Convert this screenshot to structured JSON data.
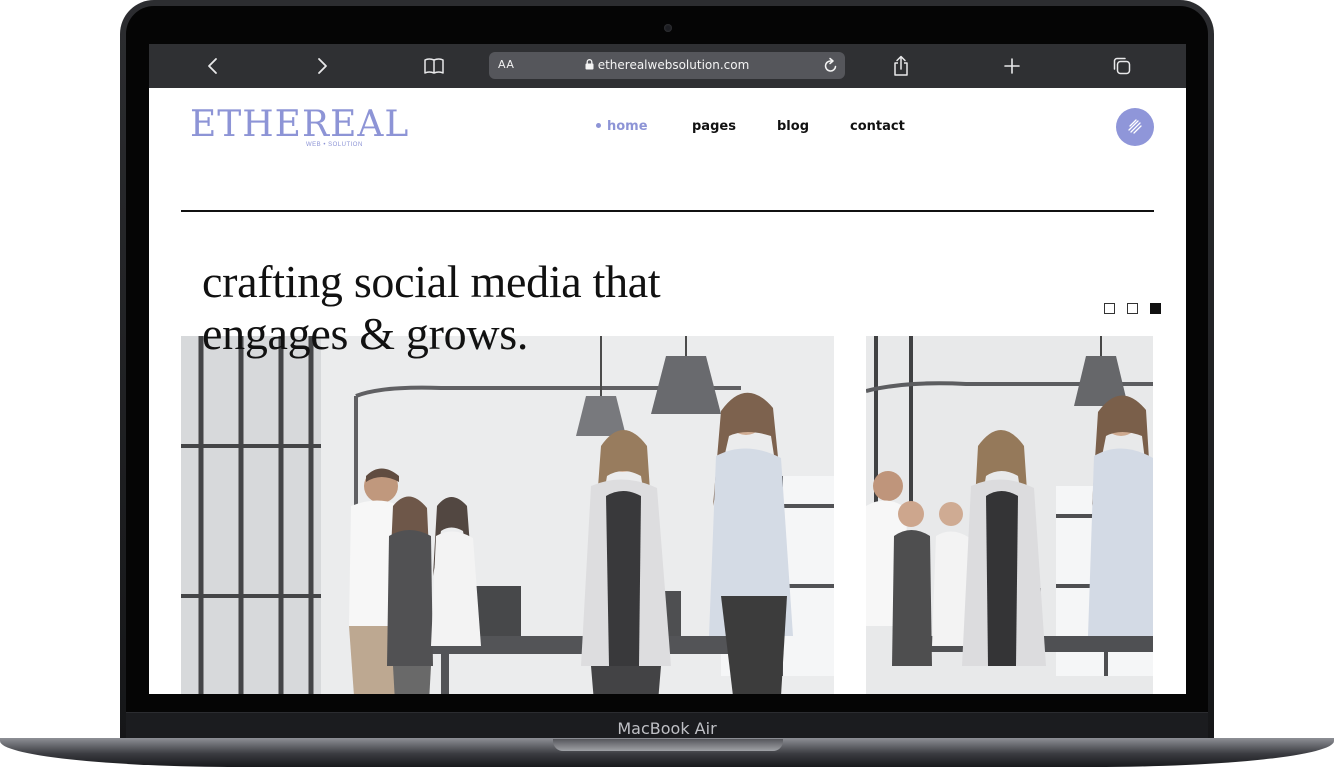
{
  "browser": {
    "back_icon": "chevron-left-icon",
    "forward_icon": "chevron-right-icon",
    "bookmarks_icon": "book-icon",
    "reader_text_size_label": "AA",
    "url": "etherealwebsolution.com",
    "lock_icon": "lock-icon",
    "reload_icon": "reload-icon",
    "share_icon": "share-icon",
    "new_tab_icon": "plus-icon",
    "tabs_icon": "tabs-icon"
  },
  "site": {
    "logo_text": "ETHEREAL",
    "logo_tagline": "WEB • SOLUTION",
    "nav": [
      {
        "label": "home",
        "active": true
      },
      {
        "label": "pages",
        "active": false
      },
      {
        "label": "blog",
        "active": false
      },
      {
        "label": "contact",
        "active": false
      }
    ],
    "menu_icon": "menu-lines-icon",
    "headline_line1": "crafting social media that",
    "headline_line2": "engages & grows.",
    "slider_dots": [
      false,
      false,
      true
    ]
  },
  "device": {
    "label": "MacBook Air"
  },
  "colors": {
    "accent": "#8d94d6",
    "toolbar": "#2f3033",
    "text": "#111111"
  }
}
